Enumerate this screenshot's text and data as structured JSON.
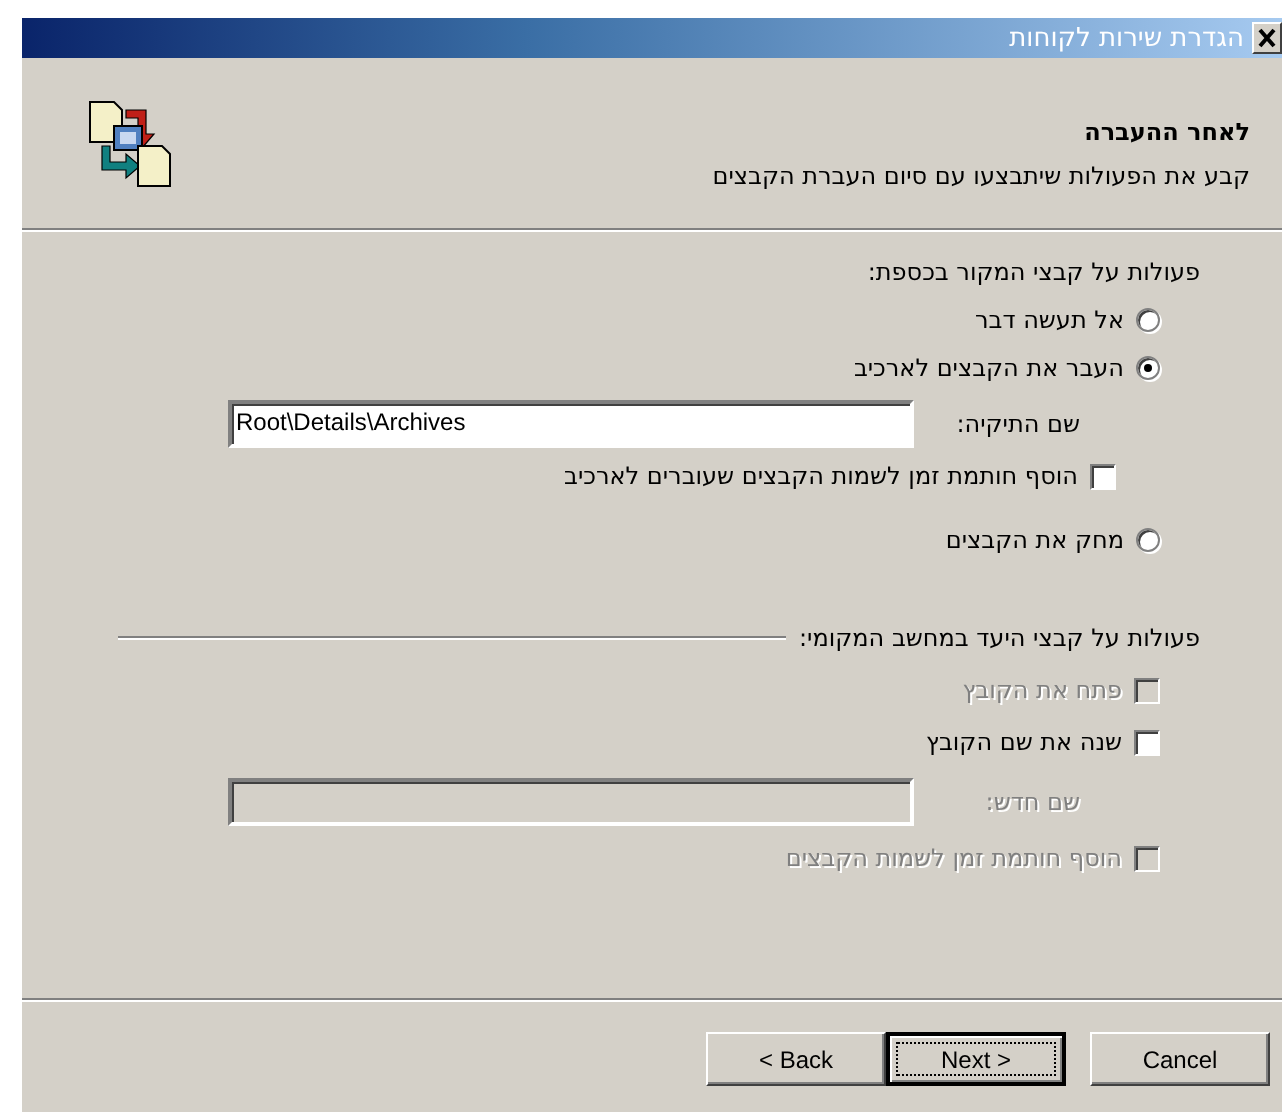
{
  "window": {
    "title": "הגדרת שירות לקוחות"
  },
  "header": {
    "title": "לאחר ההעברה",
    "subtitle": "קבע את הפעולות שיתבצעו עם סיום העברת הקבצים"
  },
  "source_section": {
    "label": "פעולות על קבצי המקור בכספת:",
    "options": [
      {
        "kind": "radio",
        "label": "אל תעשה דבר",
        "selected": false
      },
      {
        "kind": "radio",
        "label": "העבר את הקבצים לארכיב",
        "selected": true
      },
      {
        "kind": "field",
        "label": "שם התיקיה:",
        "value": "Root\\Details\\Archives",
        "disabled": false
      },
      {
        "kind": "checkbox",
        "label": "הוסף חותמת זמן לשמות הקבצים שעוברים לארכיב",
        "checked": false,
        "disabled": false
      },
      {
        "kind": "radio",
        "label": "מחק את הקבצים",
        "selected": false
      }
    ]
  },
  "target_section": {
    "label": "פעולות על קבצי היעד במחשב המקומי:",
    "options": [
      {
        "kind": "checkbox",
        "label": "פתח את הקובץ",
        "checked": false,
        "disabled": true
      },
      {
        "kind": "checkbox",
        "label": "שנה את שם הקובץ",
        "checked": false,
        "disabled": false
      },
      {
        "kind": "field",
        "label": "שם חדש:",
        "disabled": true
      },
      {
        "kind": "checkbox",
        "label": "הוסף חותמת זמן לשמות הקבצים",
        "checked": false,
        "disabled": true
      }
    ]
  },
  "buttons": [
    {
      "label": "Cancel",
      "default": false
    },
    {
      "label": "Next >",
      "default": true
    },
    {
      "label": "< Back",
      "default": false
    }
  ]
}
